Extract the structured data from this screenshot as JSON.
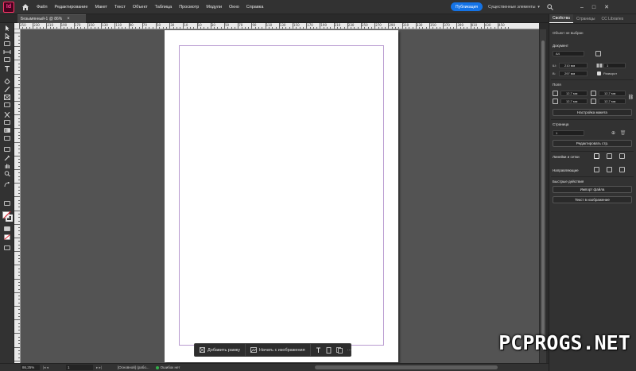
{
  "app": {
    "logo": "Id"
  },
  "menu": [
    "Файл",
    "Редактирование",
    "Макет",
    "Текст",
    "Объект",
    "Таблица",
    "Просмотр",
    "Модули",
    "Окно",
    "Справка"
  ],
  "header": {
    "publish_label": "Публикация",
    "workspace_label": "Существенные элементы"
  },
  "document_tab": {
    "title": "Безымянный-1 @ 86%"
  },
  "ruler": {
    "h_labels": [
      "250",
      "230",
      "210",
      "190",
      "170",
      "150",
      "130",
      "110",
      "90",
      "70",
      "50",
      "30",
      "10",
      "10",
      "30",
      "50",
      "70",
      "90",
      "110",
      "130",
      "150",
      "170",
      "190",
      "210",
      "230",
      "250",
      "270",
      "290",
      "310",
      "330",
      "350",
      "370",
      "390",
      "410",
      "430",
      "450"
    ]
  },
  "taskbar": {
    "add_frame_label": "Добавить рамку",
    "start_image_label": "Начать с изображения",
    "more_label": "···"
  },
  "statusbar": {
    "zoom": "86,25%",
    "page": "1",
    "preset": "[Основной] (рабо...",
    "errors": "Ошибок нет"
  },
  "panel": {
    "tabs": [
      "Свойства",
      "Страницы",
      "CC Libraries"
    ],
    "subtitle": "Объект не выбран",
    "document": {
      "title": "Документ",
      "preset": "A4",
      "width_label": "Ш:",
      "width": "210 мм",
      "height_label": "В:",
      "height": "297 мм",
      "pages": "1",
      "facing_label": "Разворот"
    },
    "margins": {
      "title": "Поля",
      "top": "12,7 мм",
      "bottom": "12,7 мм",
      "left": "12,7 мм",
      "right": "12,7 мм",
      "layout_button": "Настройка макета"
    },
    "page": {
      "title": "Страница",
      "value": "1",
      "edit_button": "Редактировать стр."
    },
    "rulers_grids": {
      "title": "Линейки и сетки"
    },
    "guides": {
      "title": "Направляющие"
    },
    "quick_actions": {
      "title": "Быстрые действия",
      "import_button": "Импорт файла",
      "text_to_image_button": "Текст в изображение"
    }
  },
  "watermark": "PCPROGS.NET",
  "colors": {
    "accent": "#1473e6",
    "logo_bg": "#49021f",
    "logo_fg": "#ff3c8e",
    "margin_guide": "#b89ad0",
    "status_ok": "#33b04a"
  }
}
